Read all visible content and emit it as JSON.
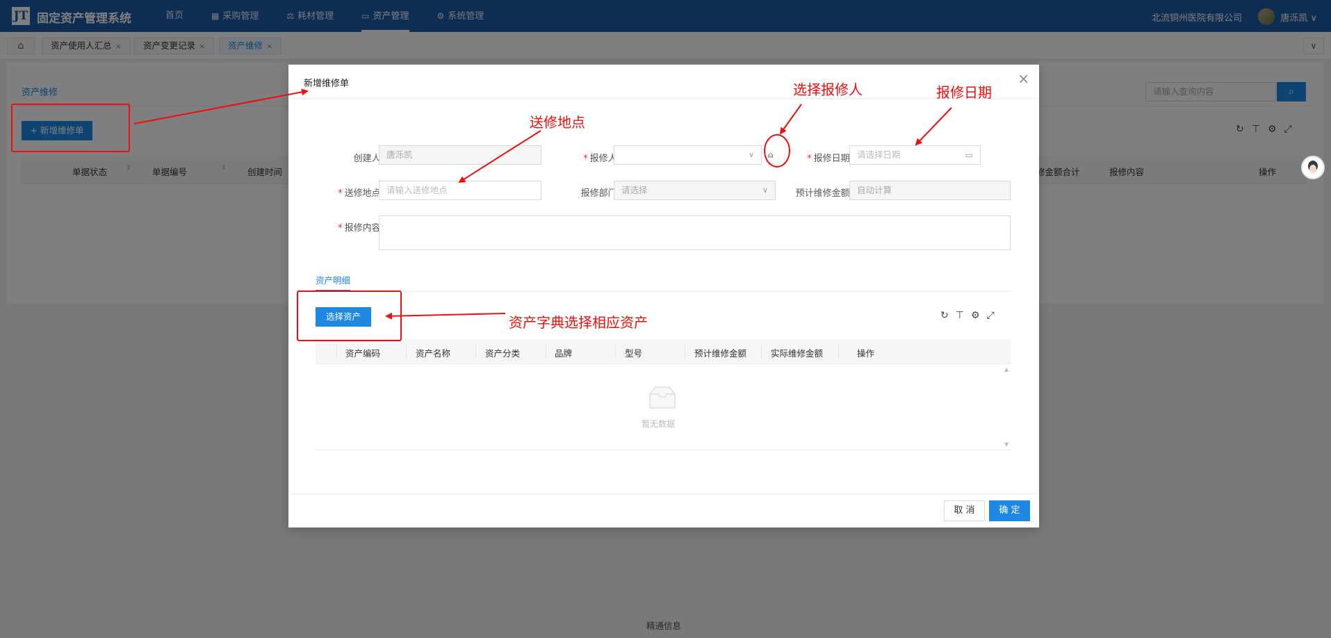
{
  "app": {
    "logo": "JT",
    "title": "固定资产管理系统"
  },
  "nav": [
    {
      "label": "首页",
      "icon": ""
    },
    {
      "label": "采购管理",
      "icon": "▦"
    },
    {
      "label": "耗材管理",
      "icon": "⚖"
    },
    {
      "label": "资产管理",
      "icon": "▭"
    },
    {
      "label": "系统管理",
      "icon": "⚙"
    }
  ],
  "header": {
    "company": "北流铜州医院有限公司",
    "user": "唐泺凯 ∨"
  },
  "tabs": {
    "home_icon": "⌂",
    "items": [
      "资产使用人汇总",
      "资产变更记录",
      "资产维修"
    ],
    "close": "×",
    "more_icon": "∨"
  },
  "background": {
    "title": "资产维修",
    "search_placeholder": "请输入查询内容",
    "add_button": "+ 新增维修单",
    "columns": [
      "单据状态",
      "单据编号",
      "创建时间",
      "修金额合计",
      "报修内容",
      "操作"
    ],
    "footer": "精通信息"
  },
  "modal": {
    "title": "新增维修单",
    "close": "×",
    "form": {
      "creator_label": "创建人:",
      "creator_value": "唐泺凯",
      "reporter_label": "报修人:",
      "reporter_value": "",
      "report_date_label": "报修日期:",
      "report_date_placeholder": "请选择日期",
      "location_label": "送修地点:",
      "location_placeholder": "请输入送修地点",
      "dept_label": "报修部门:",
      "dept_placeholder": "请选择",
      "amount_label": "预计维修金额:",
      "amount_placeholder": "自动计算",
      "content_label": "报修内容:",
      "content_value": ""
    },
    "section_tab": "资产明细",
    "select_asset_button": "选择资产",
    "columns": [
      "资产编码",
      "资产名称",
      "资产分类",
      "品牌",
      "型号",
      "预计维修金额",
      "实际维修金额",
      "操作"
    ],
    "empty_text": "暂无数据",
    "cancel_button": "取 消",
    "ok_button": "确 定"
  },
  "annotations": {
    "select_reporter": "选择报修人",
    "report_date": "报修日期",
    "location": "送修地点",
    "asset_dict": "资产字典选择相应资产"
  },
  "colors": {
    "primary": "#1e88e5",
    "header": "#1c5ba5",
    "annotation": "#f20c0c"
  }
}
